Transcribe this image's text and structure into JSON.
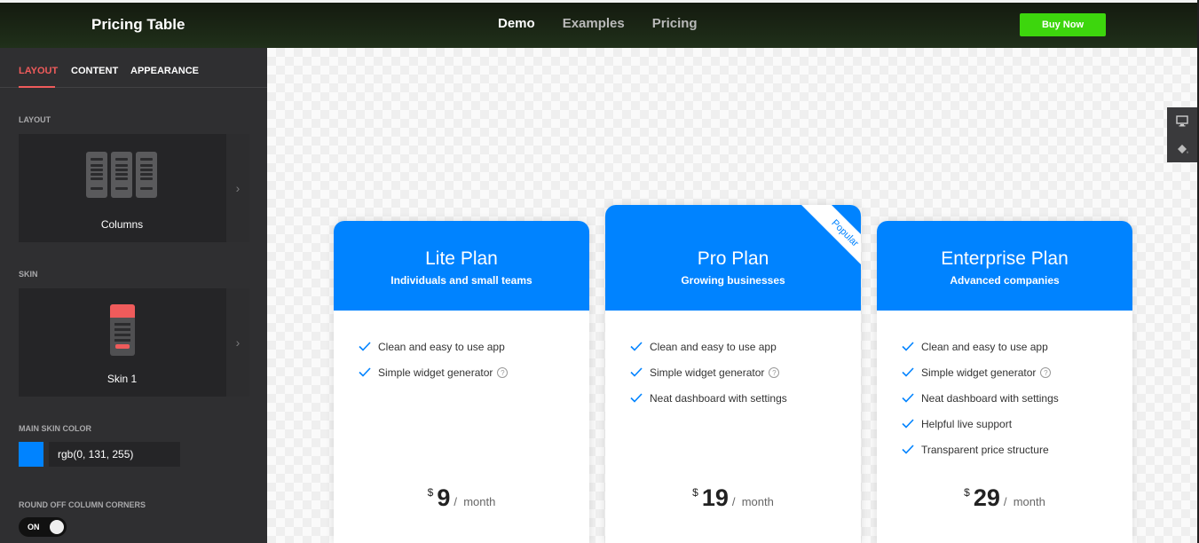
{
  "header": {
    "brand": "Pricing Table",
    "nav": [
      "Demo",
      "Examples",
      "Pricing"
    ],
    "buy_label": "Buy Now"
  },
  "sidebar": {
    "tabs": [
      "LAYOUT",
      "CONTENT",
      "APPEARANCE"
    ],
    "layout_label": "LAYOUT",
    "layout_value": "Columns",
    "skin_label": "SKIN",
    "skin_value": "Skin 1",
    "color_label": "MAIN SKIN COLOR",
    "color_value": "rgb(0, 131, 255)",
    "corners_label": "ROUND OFF COLUMN CORNERS",
    "corners_toggle": "ON"
  },
  "colors": {
    "accent": "#0083ff",
    "sidebar_accent": "#ef5b5b",
    "buy_button": "#3dd60d"
  },
  "plans": [
    {
      "name": "Lite Plan",
      "subtitle": "Individuals and small teams",
      "features": [
        "Clean and easy to use app",
        "Simple widget generator"
      ],
      "currency": "$",
      "price": "9",
      "period": "month"
    },
    {
      "name": "Pro Plan",
      "subtitle": "Growing businesses",
      "badge": "Popular",
      "features": [
        "Clean and easy to use app",
        "Simple widget generator",
        "Neat dashboard with settings"
      ],
      "currency": "$",
      "price": "19",
      "period": "month"
    },
    {
      "name": "Enterprise Plan",
      "subtitle": "Advanced companies",
      "features": [
        "Clean and easy to use app",
        "Simple widget generator",
        "Neat dashboard with settings",
        "Helpful live support",
        "Transparent price structure"
      ],
      "currency": "$",
      "price": "29",
      "period": "month"
    }
  ]
}
